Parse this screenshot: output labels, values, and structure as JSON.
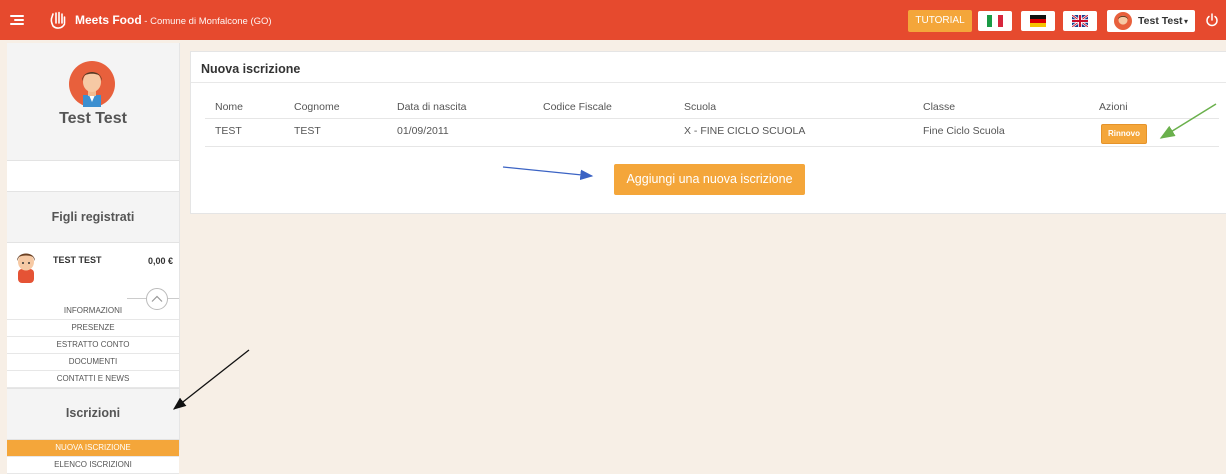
{
  "topbar": {
    "brand_name": "Meets Food",
    "brand_sub": " - Comune di Monfalcone (GO)",
    "tutorial_label": "TUTORIAL",
    "user_name": "Test Test",
    "caret": "▾",
    "flags": [
      "italian-flag",
      "german-flag",
      "uk-flag"
    ],
    "accent_color": "#e64a2e"
  },
  "sidebar": {
    "profile_name": "Test Test",
    "section_children": "Figli registrati",
    "child": {
      "name": "TEST TEST",
      "balance": "0,00 €"
    },
    "child_menu": [
      "INFORMAZIONI",
      "PRESENZE",
      "ESTRATTO CONTO",
      "DOCUMENTI",
      "CONTATTI E NEWS"
    ],
    "section_enrollments": "Iscrizioni",
    "enroll_menu": [
      "NUOVA ISCRIZIONE",
      "ELENCO ISCRIZIONI"
    ],
    "active_color": "#f4a63a"
  },
  "panel": {
    "title": "Nuova iscrizione",
    "columns": [
      "Nome",
      "Cognome",
      "Data di nascita",
      "Codice Fiscale",
      "Scuola",
      "Classe",
      "Azioni"
    ],
    "rows": [
      [
        "TEST",
        "TEST",
        "01/09/2011",
        "",
        "X - FINE CICLO SCUOLA",
        "Fine Ciclo Scuola"
      ]
    ],
    "renew_label": "Rinnovo",
    "add_label": "Aggiungi una nuova iscrizione"
  }
}
